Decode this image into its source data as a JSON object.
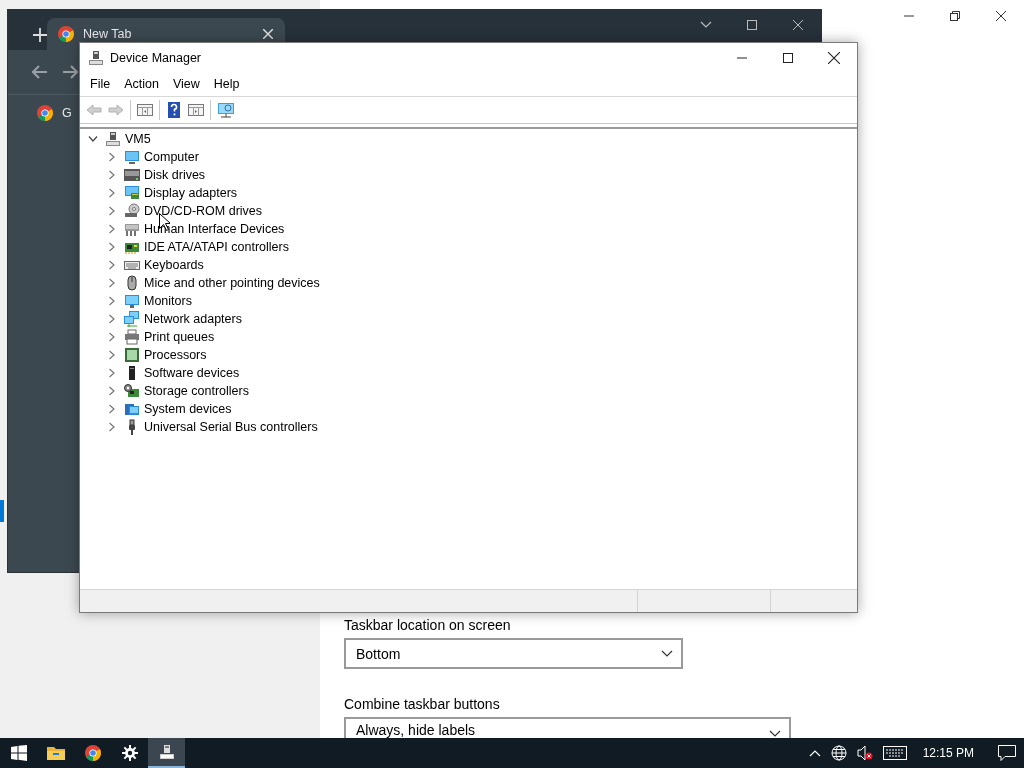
{
  "settings_window": {
    "fields": [
      {
        "label": "Taskbar location on screen",
        "value": "Bottom"
      },
      {
        "label": "Combine taskbar buttons",
        "value": "Always, hide labels"
      }
    ]
  },
  "browser_window": {
    "tabs": [
      {
        "label": "New Tab",
        "selected": true
      }
    ],
    "bookmarks": [
      {
        "label": "G"
      }
    ]
  },
  "device_manager": {
    "title": "Device Manager",
    "menu": [
      "File",
      "Action",
      "View",
      "Help"
    ],
    "toolbar": [
      {
        "kind": "back",
        "disabled": true
      },
      {
        "kind": "forward",
        "disabled": true
      },
      {
        "kind": "tree",
        "disabled": false
      },
      {
        "kind": "help",
        "disabled": false
      },
      {
        "kind": "properties",
        "disabled": false
      },
      {
        "kind": "scan",
        "disabled": false
      }
    ],
    "tree": [
      {
        "label": "VM5",
        "kind": "pc",
        "expanded": true,
        "children": [
          {
            "label": "Computer",
            "kind": "computer",
            "expanded": false
          },
          {
            "label": "Disk drives",
            "kind": "disk",
            "expanded": false
          },
          {
            "label": "Display adapters",
            "kind": "display",
            "expanded": false
          },
          {
            "label": "DVD/CD-ROM drives",
            "kind": "dvd",
            "expanded": false
          },
          {
            "label": "Human Interface Devices",
            "kind": "hid",
            "expanded": false
          },
          {
            "label": "IDE ATA/ATAPI controllers",
            "kind": "ide",
            "expanded": false
          },
          {
            "label": "Keyboards",
            "kind": "keyboard",
            "expanded": false
          },
          {
            "label": "Mice and other pointing devices",
            "kind": "mouse",
            "expanded": false
          },
          {
            "label": "Monitors",
            "kind": "monitor",
            "expanded": false
          },
          {
            "label": "Network adapters",
            "kind": "network",
            "expanded": false
          },
          {
            "label": "Print queues",
            "kind": "printer",
            "expanded": false
          },
          {
            "label": "Processors",
            "kind": "processor",
            "expanded": false
          },
          {
            "label": "Software devices",
            "kind": "software",
            "expanded": false
          },
          {
            "label": "Storage controllers",
            "kind": "storage",
            "expanded": false
          },
          {
            "label": "System devices",
            "kind": "system",
            "expanded": false
          },
          {
            "label": "Universal Serial Bus controllers",
            "kind": "usb",
            "expanded": false
          }
        ]
      }
    ]
  },
  "taskbar": {
    "apps": [
      {
        "kind": "start",
        "active": false
      },
      {
        "kind": "explorer",
        "active": false
      },
      {
        "kind": "browser",
        "active": false
      },
      {
        "kind": "settings",
        "active": false
      },
      {
        "kind": "devices",
        "active": true
      }
    ],
    "clock": "12:15 PM"
  }
}
